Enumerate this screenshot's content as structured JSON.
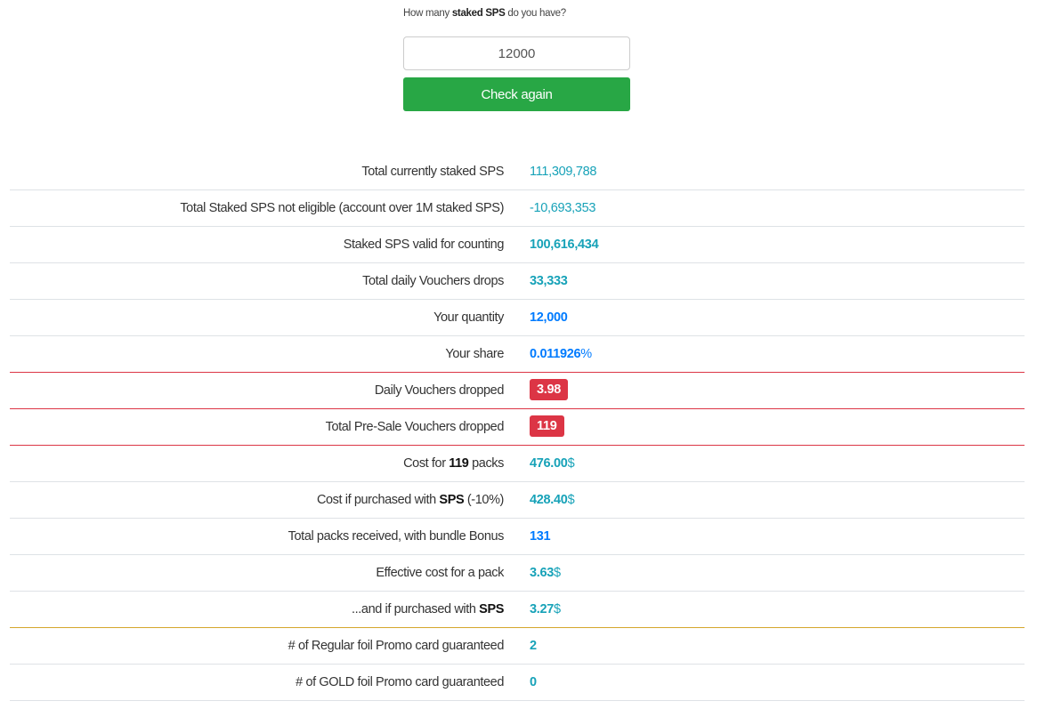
{
  "form": {
    "question_before": "How many ",
    "question_bold": "staked SPS",
    "question_after": " do you have?",
    "input_value": "12000",
    "check_button_label": "Check again"
  },
  "stats": {
    "total_staked": {
      "label": "Total currently staked SPS",
      "value": "111,309,788"
    },
    "not_eligible": {
      "label": "Total Staked SPS not eligible (account over 1M staked SPS)",
      "value": "-10,693,353"
    },
    "valid_for_counting": {
      "label": "Staked SPS valid for counting",
      "value": "100,616,434"
    },
    "daily_drops": {
      "label": "Total daily Vouchers drops",
      "value": "33,333"
    },
    "your_quantity": {
      "label": "Your quantity",
      "value": "12,000"
    },
    "your_share": {
      "label": "Your share",
      "value": "0.011926",
      "unit": "%"
    },
    "daily_vouchers_dropped": {
      "label": "Daily Vouchers dropped",
      "value": "3.98"
    },
    "presale_vouchers_dropped": {
      "label": "Total Pre-Sale Vouchers dropped",
      "value": "119"
    },
    "cost_for_packs": {
      "label_before": "Cost for ",
      "label_bold": "119",
      "label_after": " packs",
      "value": "476.00",
      "currency": "$"
    },
    "cost_with_sps": {
      "label_before": "Cost if purchased with ",
      "label_bold": "SPS",
      "label_after": " (-10%)",
      "value": "428.40",
      "currency": "$"
    },
    "total_packs": {
      "label": "Total packs received, with bundle Bonus",
      "value": "131"
    },
    "effective_cost": {
      "label": "Effective cost for a pack",
      "value": "3.63",
      "currency": "$"
    },
    "effective_cost_sps": {
      "label_before": "...and if purchased with ",
      "label_bold": "SPS",
      "value": "3.27",
      "currency": "$"
    },
    "regular_promo": {
      "label": "# of Regular foil Promo card guaranteed",
      "value": "2"
    },
    "gold_promo": {
      "label": "# of GOLD foil Promo card guaranteed",
      "value": "0"
    }
  },
  "colors": {
    "success_button": "#28a745",
    "info_value": "#17a2b8",
    "primary_value": "#007bff",
    "danger_badge": "#dc3545",
    "row_divider": "#dee2e6",
    "gold_divider": "#d4a72c"
  }
}
